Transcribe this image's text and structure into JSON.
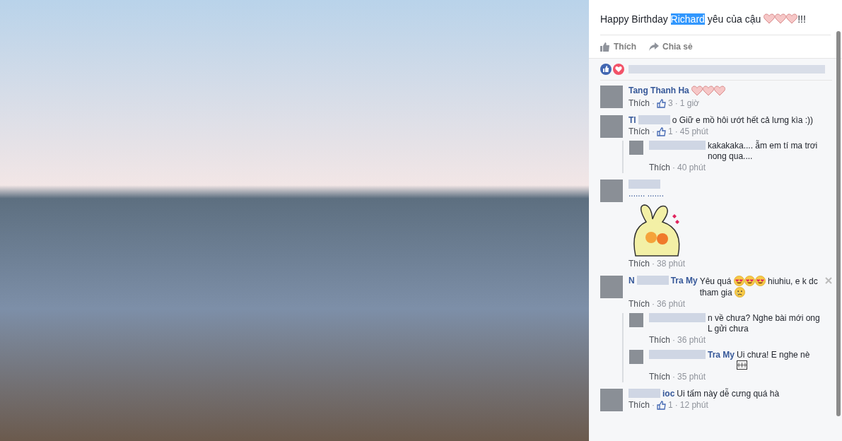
{
  "photo": {
    "kind": "photo"
  },
  "caption": [
    {
      "kind": "text",
      "text": "Happy Birthday ",
      "selected": false
    },
    {
      "kind": "text",
      "text": "Richard",
      "selected": true
    },
    {
      "kind": "text",
      "text": " yêu của cậu ",
      "selected": false
    },
    {
      "kind": "heart"
    },
    {
      "kind": "heart"
    },
    {
      "kind": "heart"
    },
    {
      "kind": "text",
      "text": "!!!",
      "selected": false
    }
  ],
  "actions": [
    {
      "kind": "like",
      "label": "Thích"
    },
    {
      "kind": "share",
      "label": "Chia sẻ"
    }
  ],
  "comments": [
    {
      "name": [
        {
          "kind": "text",
          "text": "Tang Thanh Ha"
        }
      ],
      "parts": [
        {
          "kind": "heart"
        },
        {
          "kind": "heart"
        },
        {
          "kind": "heart"
        }
      ],
      "meta": [
        {
          "kind": "like",
          "text": "Thích"
        },
        {
          "kind": "sep",
          "text": "·"
        },
        {
          "kind": "likes",
          "text": "3"
        },
        {
          "kind": "sep",
          "text": "·"
        },
        {
          "kind": "time",
          "text": "1 giờ"
        }
      ]
    },
    {
      "name": [
        {
          "kind": "text",
          "text": "Tl"
        },
        {
          "kind": "blur"
        }
      ],
      "parts": [
        {
          "kind": "text",
          "text": "o Giữ e mồ hôi ướt hết cả lưng kìa :))"
        }
      ],
      "meta": [
        {
          "kind": "like",
          "text": "Thích"
        },
        {
          "kind": "sep",
          "text": "·"
        },
        {
          "kind": "likes",
          "text": "1"
        },
        {
          "kind": "sep",
          "text": "·"
        },
        {
          "kind": "time",
          "text": "45 phút"
        }
      ],
      "replies": [
        {
          "name": [
            {
              "kind": "blur"
            }
          ],
          "parts": [
            {
              "kind": "text",
              "text": "kakakaka.... ẵm em tí ma trơi nong qua...."
            }
          ],
          "meta": [
            {
              "kind": "like",
              "text": "Thích"
            },
            {
              "kind": "sep",
              "text": "·"
            },
            {
              "kind": "time",
              "text": "40 phút"
            }
          ]
        }
      ]
    },
    {
      "name": [
        {
          "kind": "blur"
        }
      ],
      "subname": "....... .......",
      "attachment": {
        "kind": "sticker"
      },
      "meta": [
        {
          "kind": "like",
          "text": "Thích"
        },
        {
          "kind": "sep",
          "text": "·"
        },
        {
          "kind": "time",
          "text": "38 phút"
        }
      ]
    },
    {
      "name": [
        {
          "kind": "text",
          "text": "N"
        },
        {
          "kind": "blur"
        },
        {
          "kind": "text",
          "text": "Tra My"
        }
      ],
      "closable": true,
      "parts": [
        {
          "kind": "text",
          "text": "Yêu quá "
        },
        {
          "kind": "emoji"
        },
        {
          "kind": "emoji"
        },
        {
          "kind": "emoji"
        },
        {
          "kind": "text",
          "text": " hiuhiu, e k dc tham gia "
        },
        {
          "kind": "sad"
        }
      ],
      "meta": [
        {
          "kind": "like",
          "text": "Thích"
        },
        {
          "kind": "sep",
          "text": "·"
        },
        {
          "kind": "time",
          "text": "36 phút"
        }
      ],
      "replies": [
        {
          "name": [
            {
              "kind": "blur"
            }
          ],
          "parts": [
            {
              "kind": "text",
              "text": "n về chưa? Nghe bài mới ong L gửi chưa"
            }
          ],
          "meta": [
            {
              "kind": "like",
              "text": "Thích"
            },
            {
              "kind": "sep",
              "text": "·"
            },
            {
              "kind": "time",
              "text": "36 phút"
            }
          ]
        },
        {
          "name": [
            {
              "kind": "blur"
            },
            {
              "kind": "text",
              "text": "Tra My"
            }
          ],
          "parts": [
            {
              "kind": "text",
              "text": "Ui chưa! E nghe nè "
            },
            {
              "kind": "gif"
            }
          ],
          "meta": [
            {
              "kind": "like",
              "text": "Thích"
            },
            {
              "kind": "sep",
              "text": "·"
            },
            {
              "kind": "time",
              "text": "35 phút"
            }
          ]
        }
      ]
    },
    {
      "name": [
        {
          "kind": "blur"
        },
        {
          "kind": "text",
          "text": "ioc"
        }
      ],
      "parts": [
        {
          "kind": "text",
          "text": "Ui tấm này dễ cưng quá hà"
        }
      ],
      "meta": [
        {
          "kind": "like",
          "text": "Thích"
        },
        {
          "kind": "sep",
          "text": "·"
        },
        {
          "kind": "likes",
          "text": "1"
        },
        {
          "kind": "sep",
          "text": "·"
        },
        {
          "kind": "time",
          "text": "12 phút"
        }
      ]
    }
  ]
}
